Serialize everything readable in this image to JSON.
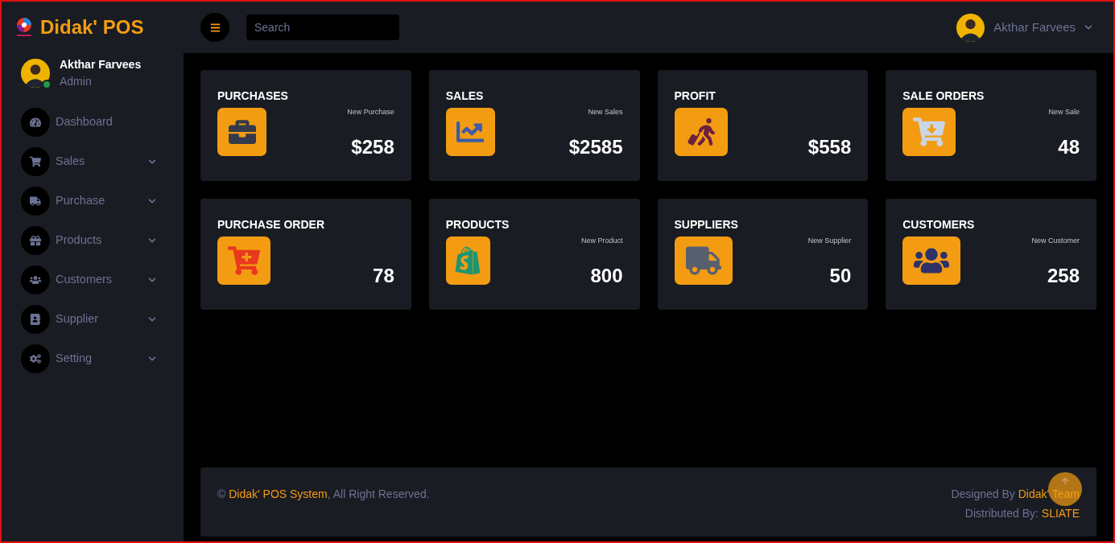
{
  "brand": {
    "name": "Didak' POS"
  },
  "search": {
    "placeholder": "Search"
  },
  "user": {
    "name": "Akthar Farvees",
    "role": "Admin",
    "online": true
  },
  "header_user": {
    "name": "Akthar Farvees"
  },
  "sidebar": {
    "items": [
      {
        "label": "Dashboard",
        "kind": "link"
      },
      {
        "label": "Sales",
        "kind": "menu",
        "expanded": false
      },
      {
        "label": "Purchase",
        "kind": "menu",
        "expanded": false
      },
      {
        "label": "Products",
        "kind": "menu",
        "expanded": false
      },
      {
        "label": "Customers",
        "kind": "menu",
        "expanded": false
      },
      {
        "label": "Supplier",
        "kind": "menu",
        "expanded": false
      },
      {
        "label": "Setting",
        "kind": "menu",
        "expanded": false
      }
    ]
  },
  "cards": [
    {
      "title": "PURCHASES",
      "link": "New Purchase",
      "value": "$258"
    },
    {
      "title": "SALES",
      "link": "New Sales",
      "value": "$2585"
    },
    {
      "title": "PROFIT",
      "value": "$558"
    },
    {
      "title": "SALE ORDERS",
      "link": "New Sale",
      "value": "48"
    },
    {
      "title": "PURCHASE ORDER",
      "value": "78"
    },
    {
      "title": "PRODUCTS",
      "link": "New Product",
      "value": "800"
    },
    {
      "title": "SUPPLIERS",
      "link": "New Supplier",
      "value": "50"
    },
    {
      "title": "CUSTOMERS",
      "link": "New Customer",
      "value": "258"
    }
  ],
  "footer": {
    "copyright": {
      "prefix": "©",
      "link": "Didak' POS System",
      "suffix": ", All Right Reserved."
    },
    "designed": {
      "label": "Designed By",
      "link": "Didak' Team"
    },
    "distributed": {
      "label": "Distributed By:",
      "link": "SLIATE"
    }
  }
}
